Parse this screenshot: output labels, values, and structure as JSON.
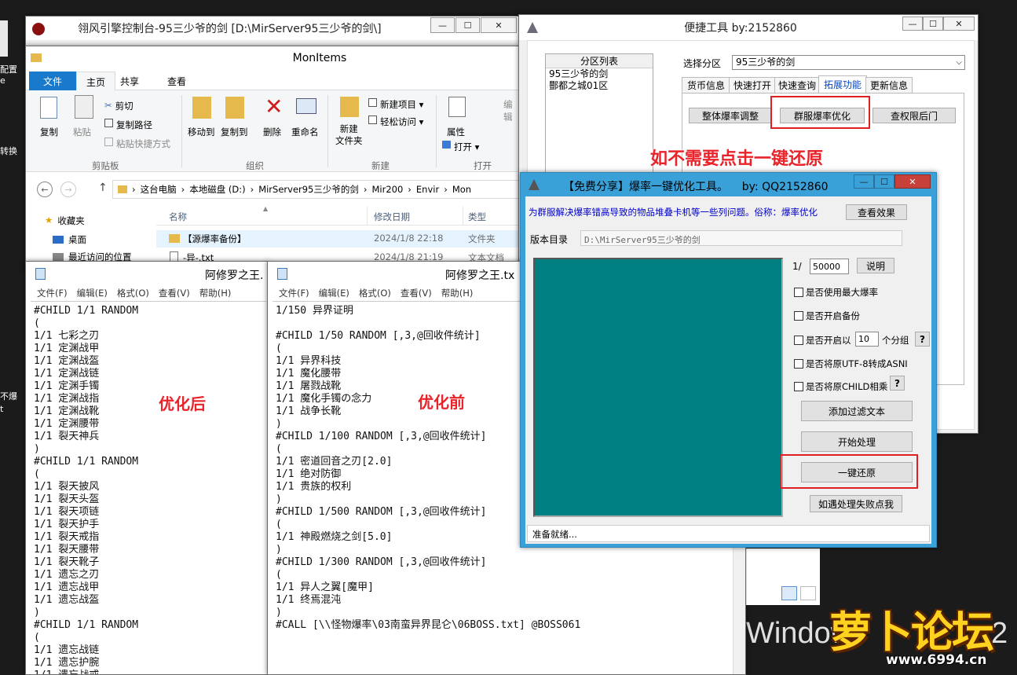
{
  "desktop": {
    "left_labels": [
      "配置",
      "e",
      "转换",
      "不爆",
      "t"
    ],
    "watermark_text": "Windows",
    "watermark_num": "2",
    "logo": {
      "name": "萝卜论坛",
      "url": "www.6994.cn"
    }
  },
  "explorer_back": {
    "title": "翎风引擎控制台-95三少爷的剑 [D:\\MirServer95三少爷的剑\\]",
    "min": "—",
    "max": "☐",
    "close": "✕"
  },
  "explorer": {
    "title": "MonItems",
    "tabs": [
      "文件",
      "主页",
      "共享",
      "查看"
    ],
    "ribbon": {
      "clipboard": {
        "copy": "复制",
        "paste": "粘贴",
        "cut": "剪切",
        "copy_path": "复制路径",
        "paste_shortcut": "粘贴快捷方式",
        "group": "剪贴板"
      },
      "organize": {
        "move_to": "移动到",
        "copy_to": "复制到",
        "delete": "删除",
        "rename": "重命名",
        "group": "组织"
      },
      "new": {
        "new_folder_1": "新建",
        "new_folder_2": "文件夹",
        "new_item": "新建项目 ▾",
        "easy_access": "轻松访问 ▾",
        "group": "新建"
      },
      "open": {
        "properties": "属性",
        "open": "打开 ▾",
        "edit": "编辑",
        "group": "打开"
      }
    },
    "breadcrumb": [
      "这台电脑",
      "本地磁盘 (D:)",
      "MirServer95三少爷的剑",
      "Mir200",
      "Envir",
      "Mon"
    ],
    "nav": [
      {
        "label": "收藏夹"
      },
      {
        "label": "桌面"
      },
      {
        "label": "最近访问的位置"
      }
    ],
    "columns": [
      "名称",
      "修改日期",
      "类型"
    ],
    "rows": [
      {
        "name": "【源爆率备份】",
        "date": "2024/1/8 22:18",
        "type": "文件夹"
      },
      {
        "name": "-异-.txt",
        "date": "2024/1/8 21:19",
        "type": "文本文档"
      }
    ]
  },
  "quick_tool": {
    "title": "便捷工具 by:2152860",
    "min": "—",
    "max": "☐",
    "close": "✕",
    "partition_header": "分区列表",
    "partitions": [
      "95三少爷的剑",
      "酆都之城01区"
    ],
    "select_label": "选择分区",
    "selected": "95三少爷的剑",
    "tabs": [
      "货币信息",
      "快速打开",
      "快速查询",
      "拓展功能",
      "更新信息"
    ],
    "buttons": [
      "整体爆率调整",
      "群服爆率优化",
      "查权限后门"
    ]
  },
  "annotations": {
    "restore_hint": "如不需要点击一键还原",
    "after": "优化后",
    "before": "优化前"
  },
  "optimizer": {
    "title": "【免费分享】爆率一键优化工具。    by: QQ2152860",
    "min": "—",
    "max": "☐",
    "close": "✕",
    "desc": "为群服解决爆率错高导致的物品堆叠卡机等一些列问题。俗称：爆率优化",
    "view_effect": "查看效果",
    "version_label": "版本目录",
    "version_path": "D:\\MirServer95三少爷的剑",
    "ratio_prefix": "1/",
    "ratio_value": "50000",
    "explain": "说明",
    "options": [
      {
        "label": "是否使用最大爆率"
      },
      {
        "label": "是否开启备份"
      },
      {
        "label": "是否开启以",
        "input": "10",
        "suffix": "个分组",
        "help": "?"
      },
      {
        "label": "是否将原UTF-8转成ASNI"
      },
      {
        "label": "是否将原CHILD相乘",
        "help": "?"
      }
    ],
    "actions": [
      "添加过滤文本",
      "开始处理",
      "一键还原",
      "如遇处理失败点我"
    ],
    "status": "准备就绪..."
  },
  "notepad_left": {
    "title": "阿修罗之王.",
    "menu": [
      "文件(F)",
      "编辑(E)",
      "格式(O)",
      "查看(V)",
      "帮助(H)"
    ],
    "text": "#CHILD 1/1 RANDOM\n(\n1/1 七彩之刃\n1/1 定渊战甲\n1/1 定渊战盔\n1/1 定渊战链\n1/1 定渊手镯\n1/1 定渊战指\n1/1 定渊战靴\n1/1 定渊腰带\n1/1 裂天神兵\n)\n#CHILD 1/1 RANDOM\n(\n1/1 裂天披风\n1/1 裂天头盔\n1/1 裂天项链\n1/1 裂天护手\n1/1 裂天戒指\n1/1 裂天腰带\n1/1 裂天靴子\n1/1 遗忘之刃\n1/1 遗忘战甲\n1/1 遗忘战盔\n)\n#CHILD 1/1 RANDOM\n(\n1/1 遗忘战链\n1/1 遗忘护腕\n1/1 遗忘战戒"
  },
  "notepad_right": {
    "title": "阿修罗之王.tx",
    "menu": [
      "文件(F)",
      "编辑(E)",
      "格式(O)",
      "查看(V)",
      "帮助(H)"
    ],
    "text": "1/150 异界证明\n\n#CHILD 1/50 RANDOM [,3,@回收件统计]\n(\n1/1 异界科技\n1/1 魔化腰带\n1/1 屠戮战靴\n1/1 魔化手镯の念力\n1/1 战争长靴\n)\n#CHILD 1/100 RANDOM [,3,@回收件统计]\n(\n1/1 密道回音之刃[2.0]\n1/1 绝对防御\n1/1 贵族的权利\n)\n#CHILD 1/500 RANDOM [,3,@回收件统计]\n(\n1/1 神殿燃烧之剑[5.0]\n)\n#CHILD 1/300 RANDOM [,3,@回收件统计]\n(\n1/1 异人之翼[魔甲]\n1/1 终焉混沌\n)\n#CALL [\\\\怪物爆率\\03南蛮异界昆仑\\06BOSS.txt] @BOSS061"
  }
}
